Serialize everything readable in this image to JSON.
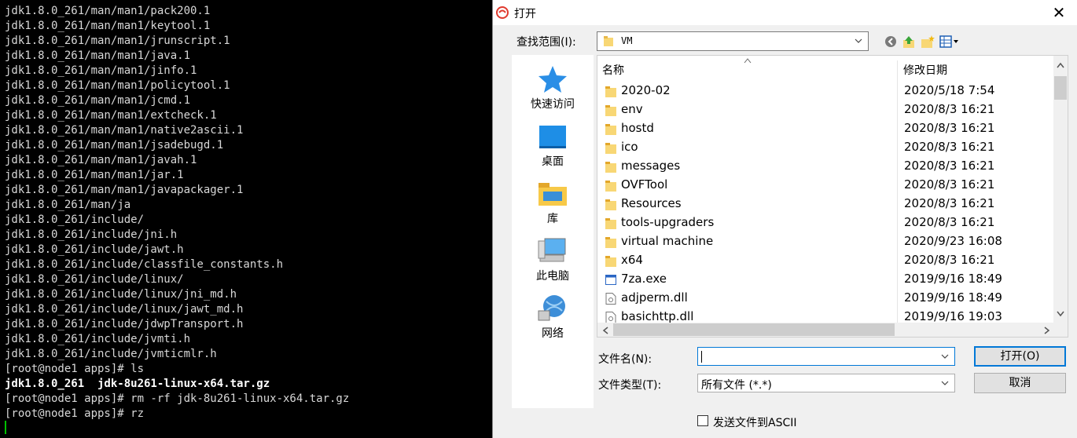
{
  "terminal": {
    "lines": [
      {
        "text": "jdk1.8.0_261/man/man1/pack200.1",
        "bold": false
      },
      {
        "text": "jdk1.8.0_261/man/man1/keytool.1",
        "bold": false
      },
      {
        "text": "jdk1.8.0_261/man/man1/jrunscript.1",
        "bold": false
      },
      {
        "text": "jdk1.8.0_261/man/man1/java.1",
        "bold": false
      },
      {
        "text": "jdk1.8.0_261/man/man1/jinfo.1",
        "bold": false
      },
      {
        "text": "jdk1.8.0_261/man/man1/policytool.1",
        "bold": false
      },
      {
        "text": "jdk1.8.0_261/man/man1/jcmd.1",
        "bold": false
      },
      {
        "text": "jdk1.8.0_261/man/man1/extcheck.1",
        "bold": false
      },
      {
        "text": "jdk1.8.0_261/man/man1/native2ascii.1",
        "bold": false
      },
      {
        "text": "jdk1.8.0_261/man/man1/jsadebugd.1",
        "bold": false
      },
      {
        "text": "jdk1.8.0_261/man/man1/javah.1",
        "bold": false
      },
      {
        "text": "jdk1.8.0_261/man/man1/jar.1",
        "bold": false
      },
      {
        "text": "jdk1.8.0_261/man/man1/javapackager.1",
        "bold": false
      },
      {
        "text": "jdk1.8.0_261/man/ja",
        "bold": false
      },
      {
        "text": "jdk1.8.0_261/include/",
        "bold": false
      },
      {
        "text": "jdk1.8.0_261/include/jni.h",
        "bold": false
      },
      {
        "text": "jdk1.8.0_261/include/jawt.h",
        "bold": false
      },
      {
        "text": "jdk1.8.0_261/include/classfile_constants.h",
        "bold": false
      },
      {
        "text": "jdk1.8.0_261/include/linux/",
        "bold": false
      },
      {
        "text": "jdk1.8.0_261/include/linux/jni_md.h",
        "bold": false
      },
      {
        "text": "jdk1.8.0_261/include/linux/jawt_md.h",
        "bold": false
      },
      {
        "text": "jdk1.8.0_261/include/jdwpTransport.h",
        "bold": false
      },
      {
        "text": "jdk1.8.0_261/include/jvmti.h",
        "bold": false
      },
      {
        "text": "jdk1.8.0_261/include/jvmticmlr.h",
        "bold": false
      },
      {
        "text": "[root@node1 apps]# ls",
        "bold": false
      },
      {
        "text": "jdk1.8.0_261  jdk-8u261-linux-x64.tar.gz",
        "bold": true
      },
      {
        "text": "[root@node1 apps]# rm -rf jdk-8u261-linux-x64.tar.gz",
        "bold": false
      },
      {
        "text": "[root@node1 apps]# rz",
        "bold": false
      }
    ]
  },
  "dialog": {
    "title": "打开",
    "close_glyph": "✕",
    "lookin_label": "查找范围(I):",
    "lookin_value": "VM",
    "places": [
      {
        "label": "快速访问",
        "icon": "star-icon"
      },
      {
        "label": "桌面",
        "icon": "desktop-icon"
      },
      {
        "label": "库",
        "icon": "library-icon"
      },
      {
        "label": "此电脑",
        "icon": "computer-icon"
      },
      {
        "label": "网络",
        "icon": "network-icon"
      }
    ],
    "columns": {
      "name": "名称",
      "date": "修改日期"
    },
    "files": [
      {
        "name": "2020-02",
        "date": "2020/5/18 7:54",
        "type": "folder"
      },
      {
        "name": "env",
        "date": "2020/8/3 16:21",
        "type": "folder"
      },
      {
        "name": "hostd",
        "date": "2020/8/3 16:21",
        "type": "folder"
      },
      {
        "name": "ico",
        "date": "2020/8/3 16:21",
        "type": "folder"
      },
      {
        "name": "messages",
        "date": "2020/8/3 16:21",
        "type": "folder"
      },
      {
        "name": "OVFTool",
        "date": "2020/8/3 16:21",
        "type": "folder"
      },
      {
        "name": "Resources",
        "date": "2020/8/3 16:21",
        "type": "folder"
      },
      {
        "name": "tools-upgraders",
        "date": "2020/8/3 16:21",
        "type": "folder"
      },
      {
        "name": "virtual machine",
        "date": "2020/9/23 16:08",
        "type": "folder"
      },
      {
        "name": "x64",
        "date": "2020/8/3 16:21",
        "type": "folder"
      },
      {
        "name": "7za.exe",
        "date": "2019/9/16 18:49",
        "type": "exe"
      },
      {
        "name": "adjperm.dll",
        "date": "2019/9/16 18:49",
        "type": "dll"
      },
      {
        "name": "basichttp.dll",
        "date": "2019/9/16 19:03",
        "type": "dll"
      }
    ],
    "filename_label": "文件名(N):",
    "filename_value": "",
    "filetype_label": "文件类型(T):",
    "filetype_value": "所有文件 (*.*)",
    "open_button": "打开(O)",
    "cancel_button": "取消",
    "ascii_checkbox": "发送文件到ASCII"
  }
}
